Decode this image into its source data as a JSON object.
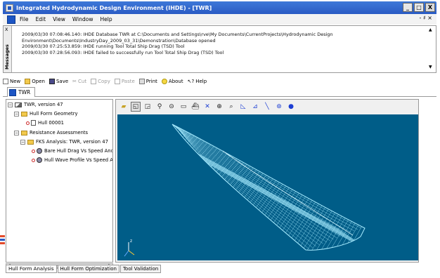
{
  "window": {
    "title": "Integrated Hydrodynamic Design Environment (IHDE) - [TWR]",
    "minimize": "_",
    "maximize": "□",
    "close": "X"
  },
  "menubar": {
    "items": [
      "File",
      "Edit",
      "View",
      "Window",
      "Help"
    ],
    "right_control": "- ♯ ×"
  },
  "messages": {
    "panel_label": "Messages",
    "close_glyph": "X",
    "lines": [
      "2009/03/30 07:08:46.140: IHDE Database TWR at C:\\Documents and Settings\\rve\\My Documents\\CurrentProjects\\Hydrodynamic Design",
      "Environment\\Documents\\IndustryDay_2009_03_31\\Demonstration\\Database opened",
      "2009/03/30 07:25:53.859: IHDE running Tool Total Ship Drag (TSD) Tool",
      "2009/03/30 07:28:56.093: IHDE failed to successfully run Tool Total Ship Drag (TSD) Tool"
    ]
  },
  "toolbar": {
    "new": "New",
    "open": "Open",
    "save": "Save",
    "cut": "Cut",
    "copy": "Copy",
    "paste": "Paste",
    "print": "Print",
    "about": "About",
    "help": "Help"
  },
  "document_tab": {
    "label": "TWR"
  },
  "tree": {
    "root": "TWR, version 47",
    "hull_form_geometry": "Hull Form Geometry",
    "hull": "Hull 00001",
    "resistance_assessments": "Resistance Assessments",
    "fks_analysis": "FKS Analysis: TWR, version 47",
    "bare_hull": "Bare Hull Drag Vs Speed And",
    "hull_wave": "Hull Wave Profile Vs Speed A"
  },
  "viewer": {
    "axis_label": "z"
  },
  "bottom_tabs": [
    "Hull Form Analysis",
    "Hull Form Optimization",
    "Tool Validation"
  ],
  "colors": {
    "title_bar": "#2a5bc4",
    "viewport_bg": "#005d88",
    "hull_mesh": "#a8ecff"
  },
  "icons": {
    "viewer_toolbar": [
      "open-folder-icon",
      "frame-icon",
      "frame-alt-icon",
      "probe-icon",
      "cylinder-icon",
      "ruler-icon",
      "ship-icon",
      "axes-icon",
      "zoom-icon",
      "zoom-region-icon",
      "triangle-icon",
      "graph-icon",
      "line-icon",
      "globe-icon",
      "sphere-icon"
    ]
  }
}
